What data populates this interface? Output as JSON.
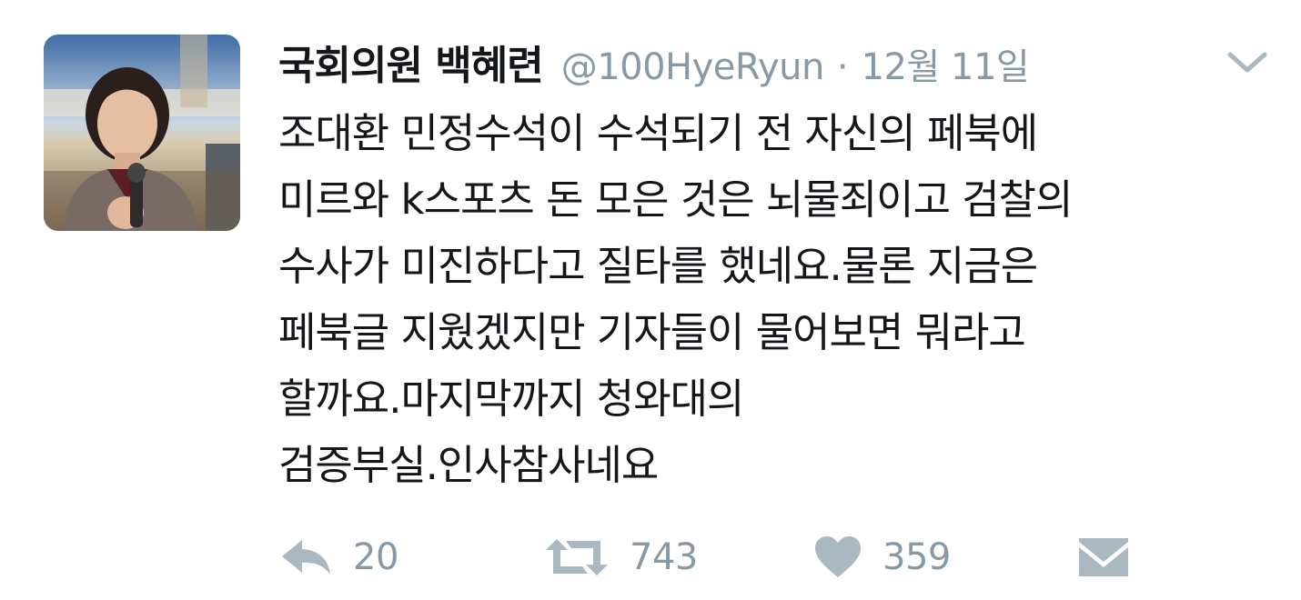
{
  "tweet": {
    "display_name": "국회의원 백혜련",
    "handle": "@100HyeRyun",
    "separator": "·",
    "date": "12월 11일",
    "text_lines": [
      "조대환 민정수석이 수석되기 전 자신의 페북에",
      "미르와 k스포츠 돈 모은 것은 뇌물죄이고 검찰의",
      "수사가 미진하다고 질타를 했네요.물론 지금은",
      "페북글 지웠겠지만 기자들이 물어보면 뭐라고",
      "할까요.마지막까지 청와대의",
      "검증부실.인사참사네요"
    ]
  },
  "actions": {
    "reply": {
      "icon": "reply-icon",
      "count": "20"
    },
    "retweet": {
      "icon": "retweet-icon",
      "count": "743"
    },
    "like": {
      "icon": "heart-icon",
      "count": "359"
    },
    "message": {
      "icon": "envelope-icon"
    }
  },
  "colors": {
    "text": "#14171a",
    "muted": "#8899a6",
    "icon": "#aab8c2"
  }
}
